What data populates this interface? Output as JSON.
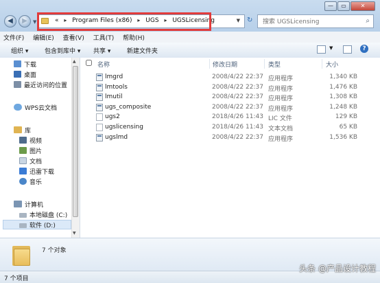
{
  "window": {
    "controls": {
      "minimize": "—",
      "maximize": "▭",
      "close": "✕"
    }
  },
  "address": {
    "prefix": "«",
    "path": [
      "Program Files (x86)",
      "UGS",
      "UGSLicensing"
    ],
    "separator": "▸"
  },
  "search": {
    "placeholder": "搜索 UGSLicensing"
  },
  "menu": {
    "items": [
      "文件(F)",
      "编辑(E)",
      "查看(V)",
      "工具(T)",
      "帮助(H)"
    ]
  },
  "toolbar": {
    "organize": "组织 ▾",
    "include_in_library": "包含到库中 ▾",
    "share": "共享 ▾",
    "new_folder": "新建文件夹"
  },
  "nav": {
    "favorites": [
      {
        "label": "下载",
        "icon": "download-folder-icon"
      },
      {
        "label": "桌面",
        "icon": "desktop-icon"
      },
      {
        "label": "最近访问的位置",
        "icon": "recent-places-icon"
      }
    ],
    "wps": "WPS云文档",
    "library_head": "库",
    "library": [
      {
        "label": "视频",
        "icon": "video-library-icon"
      },
      {
        "label": "图片",
        "icon": "pictures-library-icon"
      },
      {
        "label": "文档",
        "icon": "documents-library-icon"
      },
      {
        "label": "迅雷下载",
        "icon": "thunder-download-icon"
      },
      {
        "label": "音乐",
        "icon": "music-library-icon"
      }
    ],
    "computer_head": "计算机",
    "drives": [
      {
        "label": "本地磁盘 (C:)"
      },
      {
        "label": "软件 (D:)"
      }
    ]
  },
  "columns": {
    "name": "名称",
    "date": "修改日期",
    "type": "类型",
    "size": "大小"
  },
  "files": [
    {
      "name": "lmgrd",
      "date": "2008/4/22 22:37",
      "type": "应用程序",
      "size": "1,340 KB",
      "kind": "exe"
    },
    {
      "name": "lmtools",
      "date": "2008/4/22 22:37",
      "type": "应用程序",
      "size": "1,476 KB",
      "kind": "exe"
    },
    {
      "name": "lmutil",
      "date": "2008/4/22 22:37",
      "type": "应用程序",
      "size": "1,308 KB",
      "kind": "exe"
    },
    {
      "name": "ugs_composite",
      "date": "2008/4/22 22:37",
      "type": "应用程序",
      "size": "1,248 KB",
      "kind": "exe"
    },
    {
      "name": "ugs2",
      "date": "2018/4/26 11:43",
      "type": "LIC 文件",
      "size": "129 KB",
      "kind": "doc"
    },
    {
      "name": "ugslicensing",
      "date": "2018/4/26 11:43",
      "type": "文本文档",
      "size": "65 KB",
      "kind": "doc"
    },
    {
      "name": "ugslmd",
      "date": "2008/4/22 22:37",
      "type": "应用程序",
      "size": "1,536 KB",
      "kind": "exe"
    }
  ],
  "details": {
    "count": "7 个对象"
  },
  "status": {
    "text": "7 个项目"
  },
  "watermark": "头条 @产品设计教程"
}
